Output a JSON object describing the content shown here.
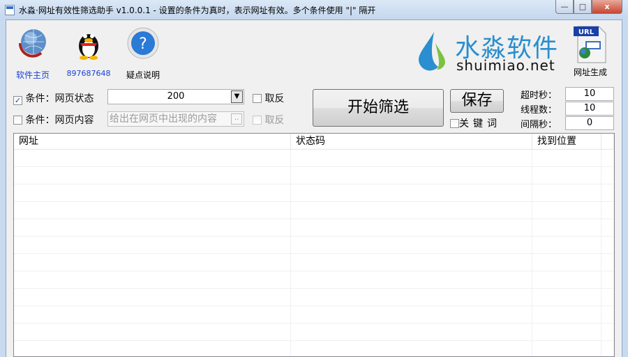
{
  "window": {
    "title": "水淼·网址有效性筛选助手 v1.0.0.1 - 设置的条件为真时，表示网址有效。多个条件使用 \"|\" 隔开",
    "min": "—",
    "max": "□",
    "close": "x"
  },
  "toolbar": {
    "home": "软件主页",
    "qq": "897687648",
    "help": "疑点说明",
    "help_glyph": "?",
    "url_gen": "网址生成",
    "url_badge": "URL"
  },
  "logo": {
    "cn": "水淼软件",
    "en": "shuimiao.net"
  },
  "conditions": [
    {
      "checked": true,
      "label": "条件：网页状态",
      "value": "200",
      "invert": "取反",
      "check_glyph": "✓",
      "arrow": "▼"
    },
    {
      "checked": false,
      "label": "条件：网页内容",
      "placeholder": "给出在网页中出现的内容",
      "invert": "取反",
      "dots": ".."
    }
  ],
  "buttons": {
    "start": "开始筛选",
    "save": "保存",
    "keyword": "关键词"
  },
  "settings": [
    {
      "label": "超时秒：",
      "value": "10"
    },
    {
      "label": "线程数：",
      "value": "10"
    },
    {
      "label": "间隔秒：",
      "value": "0"
    }
  ],
  "table": {
    "columns": [
      "网址",
      "状态码",
      "找到位置"
    ],
    "rows": []
  }
}
